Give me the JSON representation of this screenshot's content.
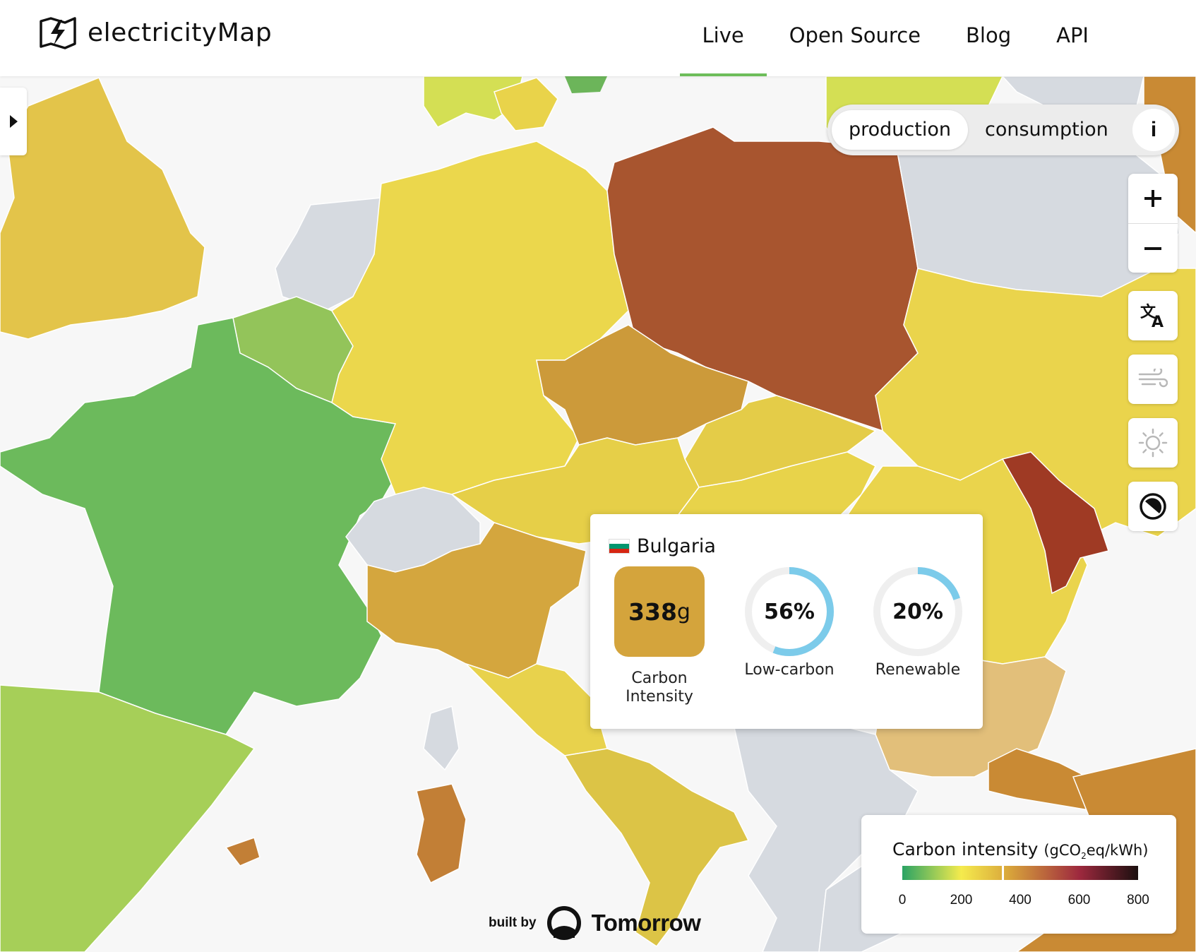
{
  "header": {
    "app_name": "electricityMap",
    "nav": [
      {
        "label": "Live",
        "active": true
      },
      {
        "label": "Open Source",
        "active": false
      },
      {
        "label": "Blog",
        "active": false
      },
      {
        "label": "API",
        "active": false
      }
    ],
    "active_underline_color": "#6dbd5a"
  },
  "mode_toggle": {
    "options": [
      "production",
      "consumption"
    ],
    "selected": "production",
    "info_label": "i"
  },
  "controls": {
    "zoom_in": "+",
    "zoom_out": "−",
    "icons": [
      "zoom-in-icon",
      "zoom-out-icon",
      "translate-icon",
      "wind-icon",
      "sun-icon",
      "dark-mode-icon"
    ]
  },
  "tooltip": {
    "country": "Bulgaria",
    "flag_colors": [
      "#ffffff",
      "#00966e",
      "#d62612"
    ],
    "carbon_intensity": {
      "value": "338",
      "unit": "g",
      "label_line1": "Carbon",
      "label_line2": "Intensity",
      "color": "#d4a43c"
    },
    "low_carbon": {
      "value": "56%",
      "fraction": 0.56,
      "label": "Low-carbon"
    },
    "renewable": {
      "value": "20%",
      "fraction": 0.2,
      "label": "Renewable"
    },
    "gauge_color": "#7ccbea"
  },
  "built_by": {
    "label": "built by",
    "company": "Tomorrow"
  },
  "legend": {
    "title": "Carbon intensity",
    "unit_prefix": "(gCO",
    "unit_sub": "2",
    "unit_suffix": "eq/kWh)",
    "ticks": [
      "0",
      "200",
      "400",
      "600",
      "800"
    ],
    "scale_colors": [
      "#2aa364",
      "#f5eb4d",
      "#9e293e",
      "#1b0f0f"
    ]
  },
  "map": {
    "country_colors": {
      "france": "#6cba5c",
      "germany": "#ebd74c",
      "poland": "#a8552f",
      "uk": "#e3c44a",
      "czech": "#cc9a3a",
      "belgium": "#93c45a",
      "netherlands": "#d6dae0",
      "switzerland": "#d6dae0",
      "austria": "#e6cf48",
      "slovakia": "#e4cc48",
      "hungary": "#e8d34a",
      "romania": "#ead44c",
      "moldova": "#9f3a24",
      "italy_north": "#d4a63e",
      "italy_center": "#e8d24c",
      "italy_south": "#dcc446",
      "sardinia": "#c27f36",
      "corsica": "#d6dae0",
      "spain": "#a6cf58",
      "bulgaria": "#e2bf7a",
      "ukraine_west": "#ead44c",
      "balkans": "#d6dae0",
      "lithuania": "#d6dae0",
      "scandinavia": "#d4df54",
      "denmark": "#e9d34a",
      "greece": "#d6dae0",
      "turkey": "#c98a34",
      "sea": "#f7f7f7"
    }
  }
}
